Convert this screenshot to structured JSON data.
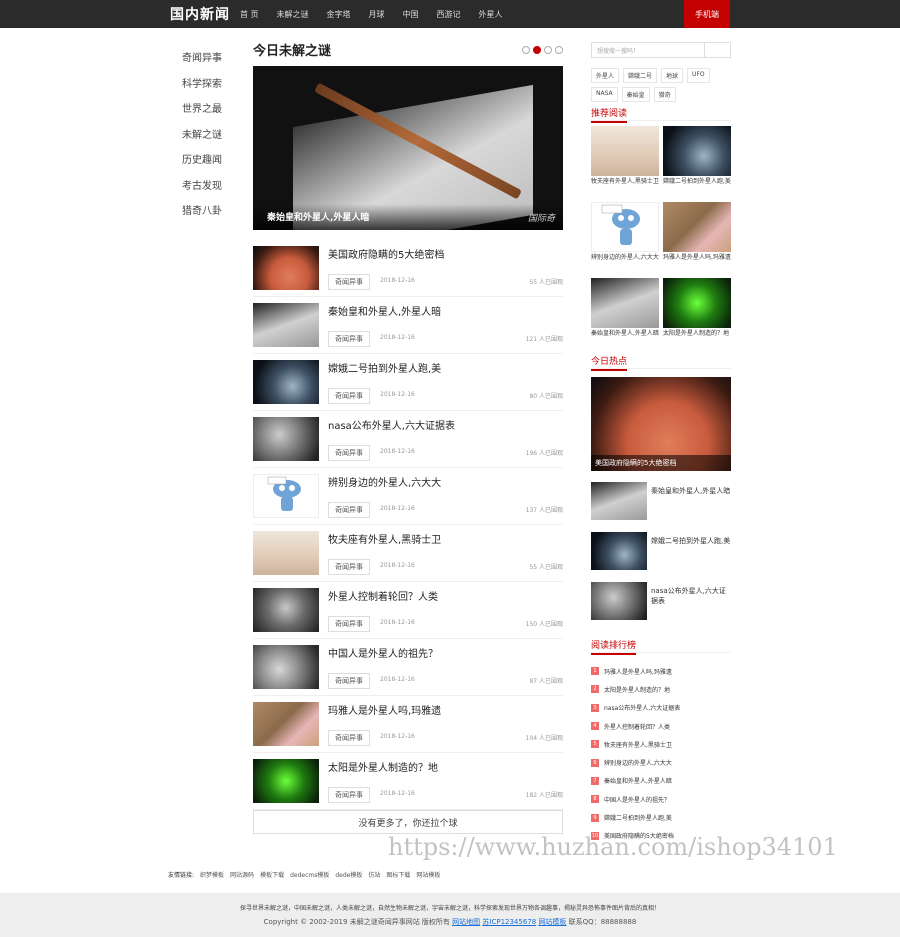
{
  "site": {
    "logo": "国内新闻",
    "nav": [
      "首 页",
      "未解之谜",
      "金字塔",
      "月球",
      "中国",
      "西游记",
      "外星人"
    ],
    "mobile_label": "手机端"
  },
  "left_menu": [
    "奇闻异事",
    "科学探索",
    "世界之最",
    "未解之谜",
    "历史趣闻",
    "考古发现",
    "猎奇八卦"
  ],
  "main": {
    "section_title": "今日未解之谜",
    "hero_caption": "秦始皇和外星人,外星人暗",
    "hero_watermark": "国际奇",
    "items": [
      {
        "title": "美国政府隐瞒的5大绝密档",
        "category": "奇闻异事",
        "date": "2018-12-16",
        "views": "55 人已围观",
        "thumb": "mars"
      },
      {
        "title": "秦始皇和外星人,外星人暗",
        "category": "奇闻异事",
        "date": "2018-12-16",
        "views": "121 人已围观",
        "thumb": "sword"
      },
      {
        "title": "嫦娥二号拍到外星人跑,美",
        "category": "奇闻异事",
        "date": "2018-12-16",
        "views": "80 人已围观",
        "thumb": "space"
      },
      {
        "title": "nasa公布外星人,六大证据表",
        "category": "奇闻异事",
        "date": "2018-12-16",
        "views": "196 人已围观",
        "thumb": "moon"
      },
      {
        "title": "辨别身边的外星人,六大大",
        "category": "奇闻异事",
        "date": "2018-12-16",
        "views": "137 人已围观",
        "thumb": "alien"
      },
      {
        "title": "牧夫座有外星人,黑骑士卫",
        "category": "奇闻异事",
        "date": "2018-12-16",
        "views": "55 人已围观",
        "thumb": "desert"
      },
      {
        "title": "外星人控制着轮回？人类",
        "category": "奇闻异事",
        "date": "2018-12-16",
        "views": "150 人已围观",
        "thumb": "grey"
      },
      {
        "title": "中国人是外星人的祖先？",
        "category": "奇闻异事",
        "date": "2018-12-16",
        "views": "87 人已围观",
        "thumb": "rock"
      },
      {
        "title": "玛雅人是外星人吗,玛雅遗",
        "category": "奇闻异事",
        "date": "2018-12-16",
        "views": "104 人已围观",
        "thumb": "maya"
      },
      {
        "title": "太阳是外星人制造的？地",
        "category": "奇闻异事",
        "date": "2018-12-16",
        "views": "182 人已围观",
        "thumb": "green"
      }
    ],
    "more_label": "没有更多了，你还拉个球"
  },
  "right": {
    "search_placeholder": "想搜搜一搜吗！",
    "tags": [
      "外星人",
      "嫦娥二号",
      "地球",
      "UFO",
      "NASA",
      "秦始皇",
      "猎奇"
    ],
    "recommend_title": "推荐阅读",
    "recommend": [
      {
        "caption": "牧夫座有外星人,黑骑士卫",
        "thumb": "desert"
      },
      {
        "caption": "嫦娥二号拍到外星人跑,美",
        "thumb": "space"
      },
      {
        "caption": "辨别身边的外星人,六大大",
        "thumb": "alien"
      },
      {
        "caption": "玛雅人是外星人吗,玛雅遗",
        "thumb": "maya"
      },
      {
        "caption": "秦始皇和外星人,外星人暗",
        "thumb": "sword"
      },
      {
        "caption": "太阳是外星人制造的？地",
        "thumb": "green"
      }
    ],
    "today_title": "今日热点",
    "today_hero_caption": "美国政府隐瞒的5大绝密档",
    "today_list": [
      {
        "title": "秦始皇和外星人,外星人暗",
        "thumb": "sword"
      },
      {
        "title": "嫦娥二号拍到外星人跑,美",
        "thumb": "space"
      },
      {
        "title": "nasa公布外星人,六大证据表",
        "thumb": "moon"
      }
    ],
    "rank_title": "阅读排行榜",
    "rank": [
      "玛雅人是外星人吗,玛雅遗",
      "太阳是外星人制造的？地",
      "nasa公布外星人,六大证据表",
      "外星人控制着轮回？人类",
      "牧夫座有外星人,黑骑士卫",
      "辨别身边的外星人,六大大",
      "秦始皇和外星人,外星人暗",
      "中国人是外星人的祖先？",
      "嫦娥二号拍到外星人跑,美",
      "美国政府隐瞒的5大绝密档"
    ]
  },
  "friends": {
    "label": "友情链接:",
    "links": [
      "织梦模板",
      "网站源码",
      "模板下载",
      "dedecms模板",
      "dede模板",
      "仿站",
      "图标下载",
      "网站模板"
    ]
  },
  "watermark": "https://www.huzhan.com/ishop34101",
  "footer": {
    "line1": "探寻世界未解之谜，中国未解之谜，人类未解之谜，自然生物未解之谜，宇宙未解之谜，科学探索发现世界万物各调趣事，揭秘灵异恐怖事件图片背后的真相！",
    "copyright": "Copyright © 2002-2019 未解之谜奇闻异事网站 版权所有",
    "links": [
      "网站地图",
      "苏ICP12345678",
      "网站模板"
    ],
    "contact": "联系QQ：88888888"
  }
}
